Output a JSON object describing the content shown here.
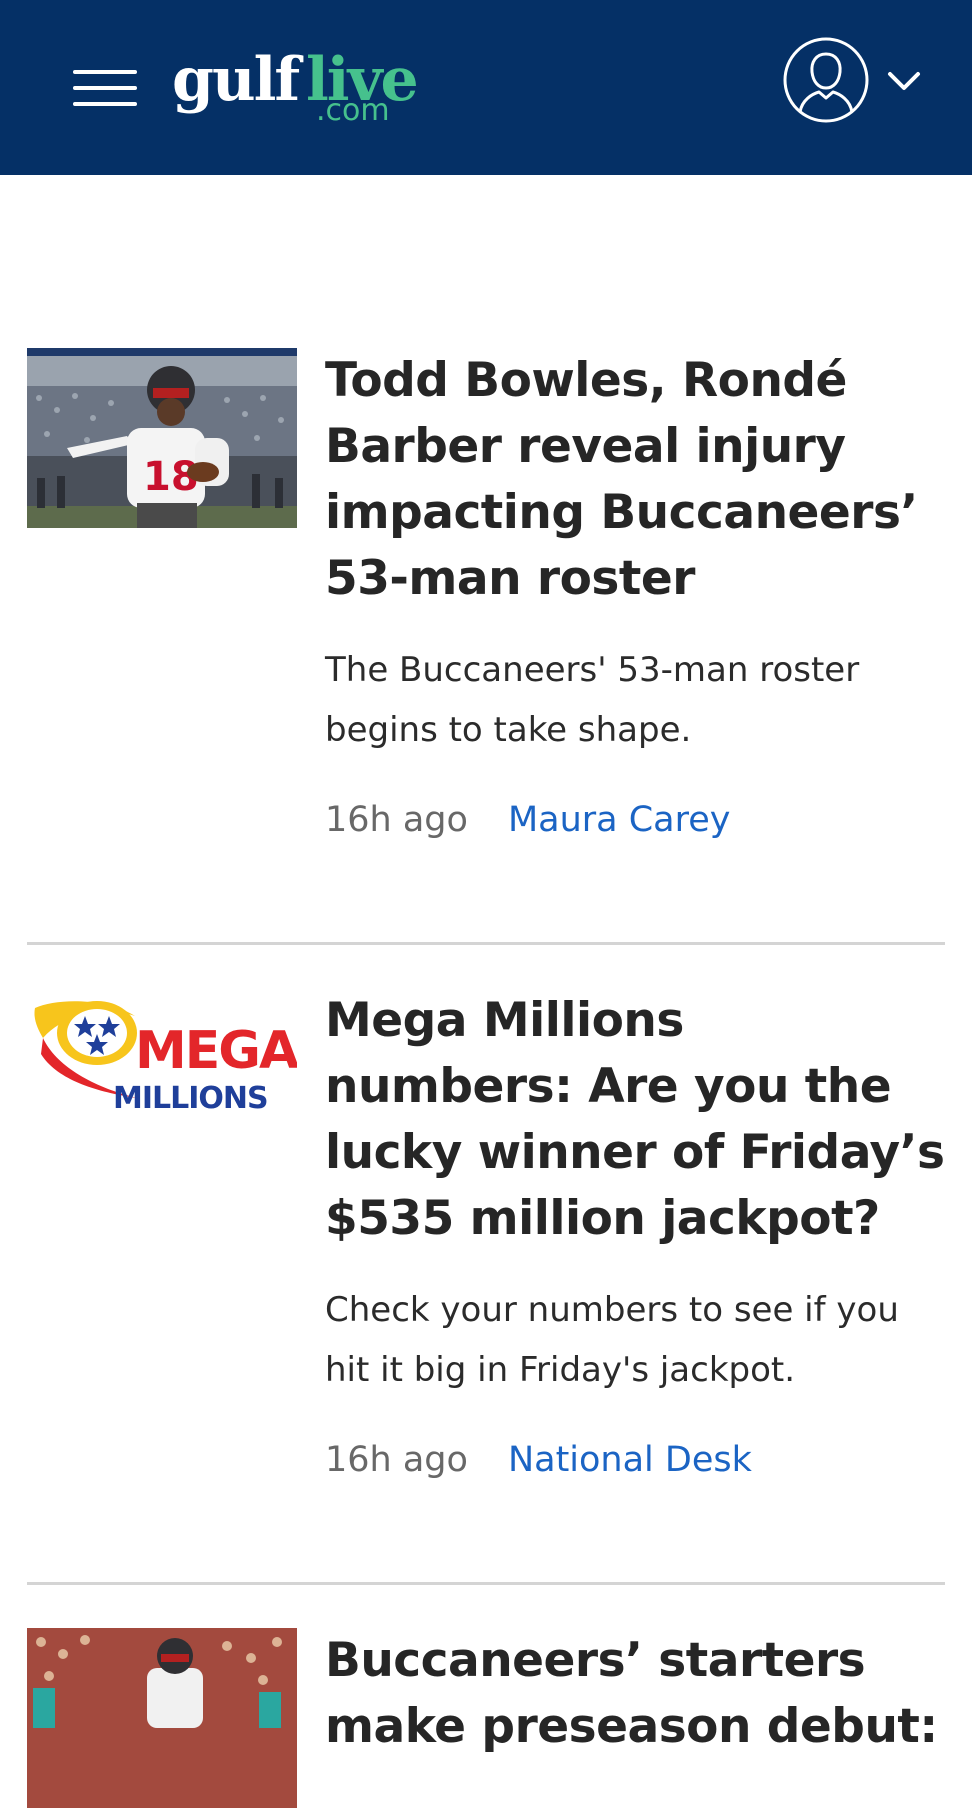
{
  "header": {
    "logo_word1": "gulf",
    "logo_word2": "live",
    "logo_domain": ".com",
    "brand_color": "#053066",
    "accent_color": "#46c18d"
  },
  "articles": [
    {
      "title": "Todd Bowles, Rondé Barber reveal injury impacting Buccaneers’ 53-man roster",
      "description": "The Buccaneers' 53-man roster begins to take shape.",
      "time": "16h ago",
      "author": "Maura Carey",
      "thumbnail": "football-player-photo"
    },
    {
      "title": "Mega Millions numbers: Are you the lucky winner of Friday’s $535 million jackpot?",
      "description": "Check your numbers to see if you hit it big in Friday's jackpot.",
      "time": "16h ago",
      "author": "National Desk",
      "thumbnail": "mega-millions-logo"
    },
    {
      "title": "Buccaneers’ starters make preseason debut:",
      "thumbnail": "football-game-photo"
    }
  ],
  "thumbnail_logo": {
    "line1": "MEGA",
    "line2": "MILLIONS"
  }
}
